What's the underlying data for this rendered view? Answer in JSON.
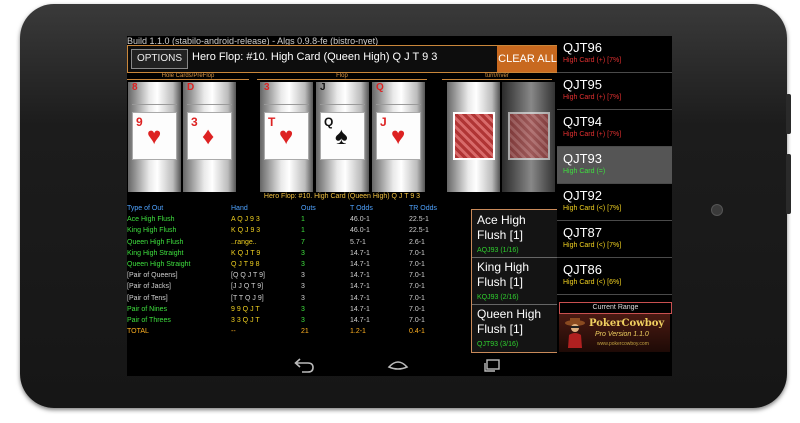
{
  "build": "Build 1.1.0 (stabilo-android-release) - Algs 0.9.8-fe (bistro-nyet)",
  "toolbar": {
    "options": "OPTIONS",
    "title": "Hero Flop: #10. High Card (Queen High) Q J T 9 3",
    "clear": "CLEAR ALL"
  },
  "sections": {
    "hole": "Hole Cards/PreFlop",
    "flop": "Flop",
    "turn": "turn/river"
  },
  "reels": [
    {
      "top": [
        "8",
        "D"
      ],
      "rank": "9",
      "suit": "♥",
      "color": "#d22"
    },
    {
      "top": [
        "D",
        "J"
      ],
      "rank": "3",
      "suit": "♦",
      "color": "#d22"
    },
    {
      "top": [
        "3",
        "D"
      ],
      "rank": "T",
      "suit": "♥",
      "color": "#d22"
    },
    {
      "top": [
        "J",
        "D"
      ],
      "rank": "Q",
      "suit": "♠",
      "color": "#111"
    },
    {
      "top": [
        "Q",
        "D"
      ],
      "rank": "J",
      "suit": "♥",
      "color": "#d22"
    }
  ],
  "status": "Hero Flop: #10. High Card (Queen High) Q J T 9 3",
  "table": {
    "headers": [
      "Type of Out",
      "Hand",
      "Outs",
      "T Odds",
      "TR Odds"
    ],
    "rows": [
      {
        "type": "Ace High Flush",
        "hand": "A Q J 9 3",
        "outs": "1",
        "t": "46.0-1",
        "tr": "22.5-1",
        "color": "#3ee03e"
      },
      {
        "type": "King High Flush",
        "hand": "K Q J 9 3",
        "outs": "1",
        "t": "46.0-1",
        "tr": "22.5-1",
        "color": "#3ee03e"
      },
      {
        "type": "Queen High Flush",
        "hand": "..range..",
        "outs": "7",
        "t": "5.7-1",
        "tr": "2.6-1",
        "color": "#3ee03e"
      },
      {
        "type": "King High Straight",
        "hand": "K Q J T 9",
        "outs": "3",
        "t": "14.7-1",
        "tr": "7.0-1",
        "color": "#3ee03e"
      },
      {
        "type": "Queen High Straight",
        "hand": "Q J T 9 8",
        "outs": "3",
        "t": "14.7-1",
        "tr": "7.0-1",
        "color": "#3ee03e"
      },
      {
        "type": "[Pair of Queens]",
        "hand": "[Q Q J T 9]",
        "outs": "3",
        "t": "14.7-1",
        "tr": "7.0-1",
        "color": "#d0d0d0"
      },
      {
        "type": "[Pair of Jacks]",
        "hand": "[J J Q T 9]",
        "outs": "3",
        "t": "14.7-1",
        "tr": "7.0-1",
        "color": "#d0d0d0"
      },
      {
        "type": "[Pair of Tens]",
        "hand": "[T T Q J 9]",
        "outs": "3",
        "t": "14.7-1",
        "tr": "7.0-1",
        "color": "#d0d0d0"
      },
      {
        "type": "Pair of Nines",
        "hand": "9 9 Q J T",
        "outs": "3",
        "t": "14.7-1",
        "tr": "7.0-1",
        "color": "#3ee03e"
      },
      {
        "type": "Pair of Threes",
        "hand": "3 3 Q J T",
        "outs": "3",
        "t": "14.7-1",
        "tr": "7.0-1",
        "color": "#3ee03e"
      },
      {
        "type": "TOTAL",
        "hand": "--",
        "outs": "21",
        "t": "1.2-1",
        "tr": "0.4-1",
        "color": "#ffb020"
      }
    ]
  },
  "outs_panel": [
    {
      "name": "Ace High Flush [1]",
      "sub": "AQJ93 (1/16)"
    },
    {
      "name": "King High Flush [1]",
      "sub": "KQJ93 (2/16)"
    },
    {
      "name": "Queen High Flush [1]",
      "sub": "QJT93 (3/16)"
    }
  ],
  "range_list": [
    {
      "name": "QJT96",
      "sub": "High Card (+) [7%]",
      "color": "#e23030"
    },
    {
      "name": "QJT95",
      "sub": "High Card (+) [7%]",
      "color": "#e23030"
    },
    {
      "name": "QJT94",
      "sub": "High Card (+) [7%]",
      "color": "#e23030"
    },
    {
      "name": "QJT93",
      "sub": "High Card (=)",
      "color": "#3ee03e",
      "selected": true
    },
    {
      "name": "QJT92",
      "sub": "High Card (<) [7%]",
      "color": "#f0d020"
    },
    {
      "name": "QJT87",
      "sub": "High Card (<) [7%]",
      "color": "#f0d020"
    },
    {
      "name": "QJT86",
      "sub": "High Card (<) [6%]",
      "color": "#f0d020"
    }
  ],
  "current_range": "Current Range",
  "logo": {
    "line1": "PokerCowboy",
    "line2": "Pro Version 1.1.0",
    "line3": "www.pokercowboy.com"
  },
  "icons": {
    "back": "back-icon",
    "home": "home-icon",
    "recent": "recent-apps-icon"
  }
}
